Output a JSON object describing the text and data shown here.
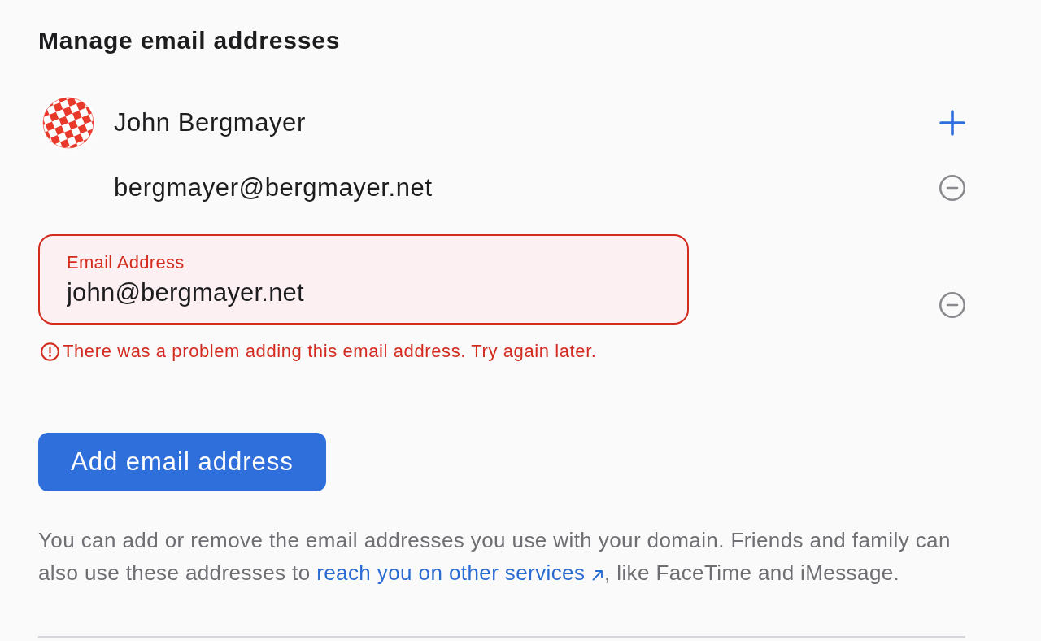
{
  "title": "Manage email addresses",
  "account": {
    "name": "John Bergmayer",
    "addresses": [
      "bergmayer@bergmayer.net"
    ]
  },
  "new_address": {
    "label": "Email Address",
    "value": "john@bergmayer.net",
    "invalid": true,
    "error": "There was a problem adding this email address. Try again later."
  },
  "add_button": "Add email address",
  "description": {
    "before": "You can add or remove the email addresses you use with your domain. Friends and family can also use these addresses to ",
    "link": "reach you on other services",
    "after": ", like FaceTime and iMessage."
  }
}
